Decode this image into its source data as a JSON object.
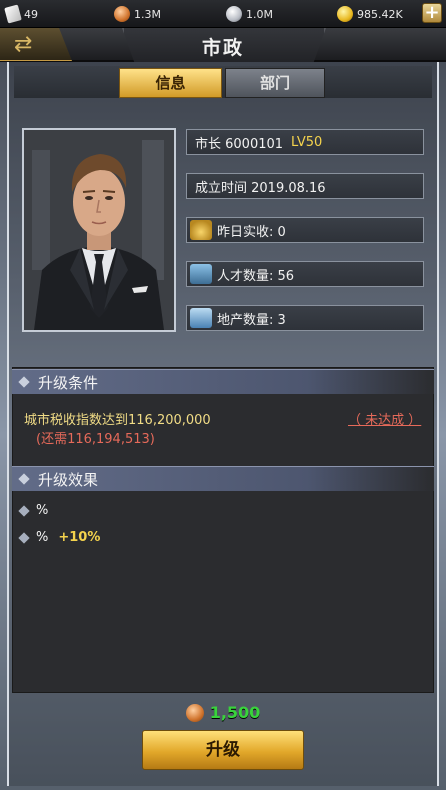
{
  "resources": {
    "cards": "49",
    "copper": "1.3M",
    "silver": "1.0M",
    "gold": "985.42K",
    "add_label": "+"
  },
  "header": {
    "title": "市政",
    "back_icon": "back-arrow-icon"
  },
  "tabs": [
    {
      "label": "信息",
      "active": true
    },
    {
      "label": "部门",
      "active": false
    }
  ],
  "info": {
    "mayor_label": "市长 6000101",
    "level": "LV50",
    "founded": "成立时间 2019.08.16",
    "yesterday_income": "昨日实收: 0",
    "talent_count": "人才数量: 56",
    "property_count": "地产数量: 3"
  },
  "upgrade_condition": {
    "header": "升级条件",
    "requirement": "城市税收指数达到116,200,000",
    "remaining": "(还需116,194,513)",
    "status": "（ 未达成 ）"
  },
  "upgrade_effect": {
    "header": "升级效果",
    "items": [
      {
        "label": "%",
        "bonus": ""
      },
      {
        "label": "%",
        "bonus": "+10%"
      }
    ]
  },
  "cost": {
    "value": "1,500"
  },
  "upgrade_button": {
    "label": "升级"
  },
  "colors": {
    "accent_gold": "#f4d34d",
    "warning_red": "#e66a5a",
    "cost_green": "#39d33c"
  }
}
